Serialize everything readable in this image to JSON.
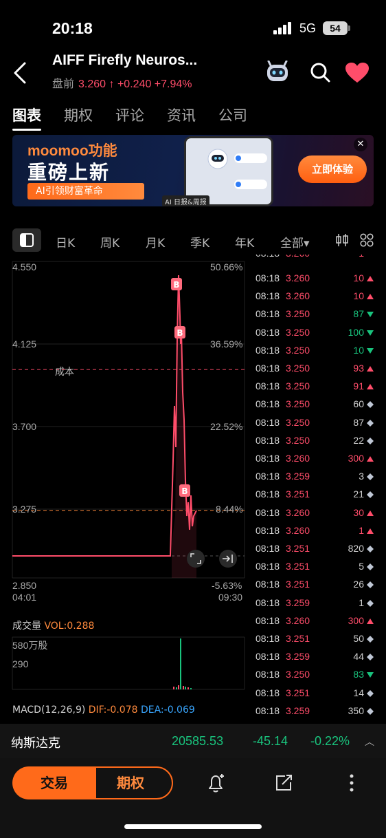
{
  "status": {
    "time": "20:18",
    "network": "5G",
    "battery": "54"
  },
  "header": {
    "title": "AIFF  Firefly Neuros...",
    "session_label": "盘前",
    "price": "3.260",
    "change": "+0.240",
    "change_pct": "+7.94%"
  },
  "tabs": [
    "图表",
    "期权",
    "评论",
    "资讯",
    "公司"
  ],
  "banner": {
    "brand": "moomoo功能",
    "headline": "重磅上新",
    "tag": "AI引领财富革命",
    "phone_label": "AI 日报&周报",
    "cta": "立即体验"
  },
  "periods": [
    "日K",
    "周K",
    "月K",
    "季K",
    "年K",
    "全部▾"
  ],
  "chart": {
    "y_left": [
      "4.550",
      "4.125",
      "3.700",
      "3.275",
      "2.850"
    ],
    "y_right": [
      "50.66%",
      "36.59%",
      "22.52%",
      "8.44%",
      "-5.63%"
    ],
    "x_start": "04:01",
    "x_end": "09:30",
    "cost_label": "成本",
    "buy_marker": "B"
  },
  "volume": {
    "label": "成交量",
    "value": "VOL:0.288",
    "y1": "580万股",
    "y2": "290"
  },
  "macd": {
    "label": "MACD(12,26,9)",
    "dif": "DIF:-0.078",
    "dea": "DEA:-0.069"
  },
  "ticks": [
    {
      "time": "08:18",
      "price": "3.260",
      "vol": "10",
      "dir": "up"
    },
    {
      "time": "08:18",
      "price": "3.260",
      "vol": "10",
      "dir": "up"
    },
    {
      "time": "08:18",
      "price": "3.250",
      "vol": "87",
      "dir": "down"
    },
    {
      "time": "08:18",
      "price": "3.250",
      "vol": "100",
      "dir": "down"
    },
    {
      "time": "08:18",
      "price": "3.250",
      "vol": "10",
      "dir": "down"
    },
    {
      "time": "08:18",
      "price": "3.250",
      "vol": "93",
      "dir": "up"
    },
    {
      "time": "08:18",
      "price": "3.250",
      "vol": "91",
      "dir": "up"
    },
    {
      "time": "08:18",
      "price": "3.250",
      "vol": "60",
      "dir": "flat"
    },
    {
      "time": "08:18",
      "price": "3.250",
      "vol": "87",
      "dir": "flat"
    },
    {
      "time": "08:18",
      "price": "3.250",
      "vol": "22",
      "dir": "flat"
    },
    {
      "time": "08:18",
      "price": "3.260",
      "vol": "300",
      "dir": "up"
    },
    {
      "time": "08:18",
      "price": "3.259",
      "vol": "3",
      "dir": "flat"
    },
    {
      "time": "08:18",
      "price": "3.251",
      "vol": "21",
      "dir": "flat"
    },
    {
      "time": "08:18",
      "price": "3.260",
      "vol": "30",
      "dir": "up"
    },
    {
      "time": "08:18",
      "price": "3.260",
      "vol": "1",
      "dir": "up"
    },
    {
      "time": "08:18",
      "price": "3.251",
      "vol": "820",
      "dir": "flat"
    },
    {
      "time": "08:18",
      "price": "3.251",
      "vol": "5",
      "dir": "flat"
    },
    {
      "time": "08:18",
      "price": "3.251",
      "vol": "26",
      "dir": "flat"
    },
    {
      "time": "08:18",
      "price": "3.259",
      "vol": "1",
      "dir": "flat"
    },
    {
      "time": "08:18",
      "price": "3.260",
      "vol": "300",
      "dir": "up"
    },
    {
      "time": "08:18",
      "price": "3.251",
      "vol": "50",
      "dir": "flat"
    },
    {
      "time": "08:18",
      "price": "3.259",
      "vol": "44",
      "dir": "flat"
    },
    {
      "time": "08:18",
      "price": "3.250",
      "vol": "83",
      "dir": "down"
    },
    {
      "time": "08:18",
      "price": "3.251",
      "vol": "14",
      "dir": "flat"
    },
    {
      "time": "08:18",
      "price": "3.259",
      "vol": "350",
      "dir": "flat"
    }
  ],
  "index": {
    "name": "纳斯达克",
    "value": "20585.53",
    "change": "-45.14",
    "change_pct": "-0.22%"
  },
  "bottom": {
    "trade": "交易",
    "options": "期权"
  },
  "colors": {
    "up": "#ff4d6a",
    "down": "#19c37d",
    "accent": "#ff6a1a"
  }
}
